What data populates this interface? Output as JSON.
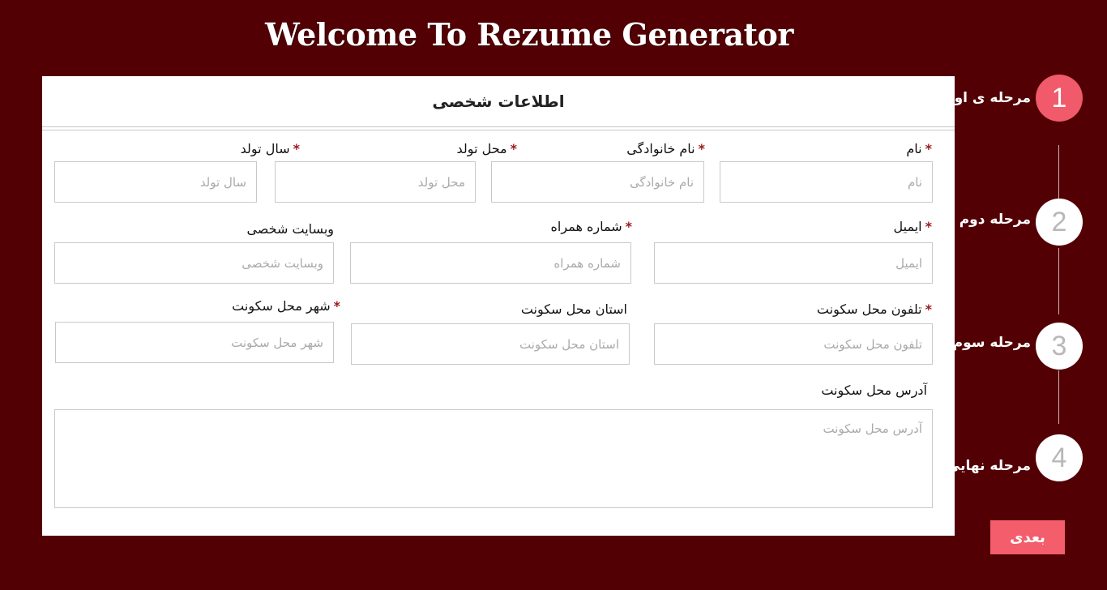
{
  "page": {
    "title": "Welcome To Rezume Generator"
  },
  "form": {
    "section_title": "اطلاعات شخصی",
    "required_mark": "*",
    "fields": {
      "first_name": {
        "label": "نام",
        "placeholder": "نام"
      },
      "last_name": {
        "label": "نام خانوادگی",
        "placeholder": "نام خانوادگی"
      },
      "birth_place": {
        "label": "محل تولد",
        "placeholder": "محل تولد"
      },
      "birth_year": {
        "label": "سال تولد",
        "placeholder": "سال تولد"
      },
      "email": {
        "label": "ایمیل",
        "placeholder": "ایمیل"
      },
      "mobile": {
        "label": "شماره همراه",
        "placeholder": "شماره همراه"
      },
      "website": {
        "label": "وبسایت شخصی",
        "placeholder": "وبسایت شخصی"
      },
      "home_phone": {
        "label": "تلفون محل سکونت",
        "placeholder": "تلفون محل سکونت"
      },
      "province": {
        "label": "استان محل سکونت",
        "placeholder": "استان محل سکونت"
      },
      "city": {
        "label": "شهر محل سکونت",
        "placeholder": "شهر محل سکونت"
      },
      "address": {
        "label": "آدرس محل سکونت",
        "placeholder": "آدرس محل سکونت"
      }
    }
  },
  "steps": [
    {
      "number": "1",
      "label": "مرحله ی اول",
      "active": true
    },
    {
      "number": "2",
      "label": "مرحله دوم",
      "active": false
    },
    {
      "number": "3",
      "label": "مرحله سوم",
      "active": false
    },
    {
      "number": "4",
      "label": "مرحله نهایی",
      "active": false
    }
  ],
  "actions": {
    "next_label": "بعدی"
  },
  "colors": {
    "background": "#520004",
    "accent": "#f35d6c",
    "required": "#9c1b20"
  }
}
